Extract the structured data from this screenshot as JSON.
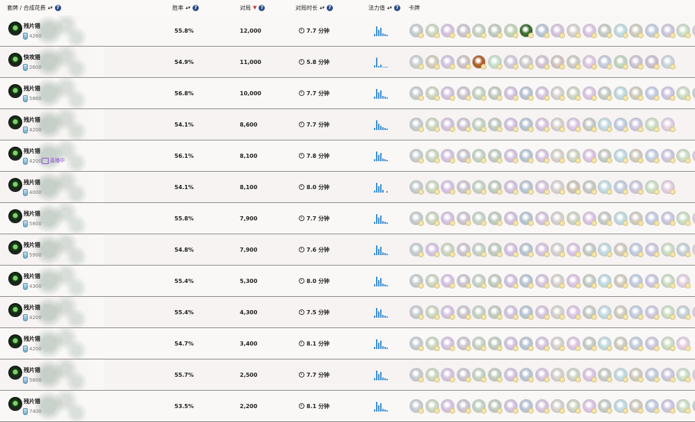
{
  "header": {
    "deck_label": "套牌 / 合成花费",
    "winrate_label": "胜率",
    "games_label": "对局",
    "duration_label": "对局时长",
    "mana_label": "法力值",
    "cards_label": "卡牌",
    "sort_glyph": "▴▾",
    "sort_active_glyph": "▼",
    "help_glyph": "?"
  },
  "rows": [
    {
      "name": "残片猎",
      "dust": "4260",
      "winrate": "55.8%",
      "games": "12,000",
      "duration": "7.7 分钟",
      "live": "",
      "mana": [
        3,
        14,
        9,
        12,
        4,
        3,
        2
      ],
      "cards": [
        "#c9d1d6",
        "#cfdac6",
        "#d9c7e8",
        "#cfc9d4",
        "#c8d7c9",
        "#c4cfc4",
        "#c6d7b9",
        "#3c6e2e",
        "#bac9d9",
        "#d9c8e2",
        "#dbd6d2",
        "#e0c9e8",
        "#c8cfc8",
        "#c4dfe6",
        "#d3cfc1",
        "#c5d0e6",
        "#d0cbe5",
        "#cfe2c8",
        "#e8d2e7"
      ]
    },
    {
      "name": "快攻猎",
      "dust": "2600",
      "winrate": "54.9%",
      "games": "11,000",
      "duration": "5.8 分钟",
      "live": "",
      "mana": [
        3,
        15,
        2,
        4,
        1,
        1,
        1
      ],
      "cards": [
        "#cfd4d6",
        "#d6cfbf",
        "#d8c8e8",
        "#d1c6c9",
        "#b3622c",
        "#c9e4d1",
        "#d4cddf",
        "#d2d2d2",
        "#d4c6d8",
        "#d8c8c5",
        "#d1cfc6",
        "#e2cce8",
        "#c8cfe0",
        "#c5d8c0",
        "#d0c7d8",
        "#cfc0d4",
        "#cddae2"
      ]
    },
    {
      "name": "残片猎",
      "dust": "5860",
      "winrate": "56.8%",
      "games": "10,000",
      "duration": "7.7 分钟",
      "live": "",
      "mana": [
        3,
        14,
        9,
        12,
        4,
        3,
        2
      ],
      "cards": [
        "#c9d1d6",
        "#cfdac6",
        "#d9c7e8",
        "#cfc9d4",
        "#c8d7c9",
        "#c4cfc4",
        "#d6c6e4",
        "#bac9d9",
        "#d9c8e2",
        "#dbd6d2",
        "#d1d8c8",
        "#e0c9e8",
        "#c8cfc8",
        "#c4dfe6",
        "#d3cfc1",
        "#c5d0e6",
        "#d0cbe5",
        "#cfe2c8",
        "#c9d5dc"
      ]
    },
    {
      "name": "残片猎",
      "dust": "4200",
      "winrate": "54.1%",
      "games": "8,600",
      "duration": "7.7 分钟",
      "live": "",
      "mana": [
        3,
        14,
        9,
        6,
        4,
        3,
        2
      ],
      "cards": [
        "#c9d1d6",
        "#cfdac6",
        "#d9c7e8",
        "#cfc9d4",
        "#c8d7c9",
        "#c4cfc4",
        "#d6c6e4",
        "#bac9d9",
        "#d9c8e2",
        "#dbd6d2",
        "#e0c9e8",
        "#c8cfc8",
        "#c4dfe6",
        "#c5d0e6",
        "#d0cbe5",
        "#cfe2c8",
        "#e8d2e7"
      ]
    },
    {
      "name": "残片猎",
      "dust": "4200",
      "winrate": "56.1%",
      "games": "8,100",
      "duration": "7.8 分钟",
      "live": "直播中",
      "mana": [
        3,
        14,
        9,
        12,
        4,
        3,
        2
      ],
      "cards": [
        "#c9d1d6",
        "#cfdac6",
        "#d9c7e8",
        "#cfc9d4",
        "#c8d7c9",
        "#c4cfc4",
        "#d6c6e4",
        "#bac9d9",
        "#d9c8e2",
        "#dbd6d2",
        "#d1d8c8",
        "#e0c9e8",
        "#c8cfc8",
        "#c4dfe6",
        "#d3cfc1",
        "#c5d0e6",
        "#d0cbe5",
        "#cfe2c8",
        "#e8d2e7"
      ]
    },
    {
      "name": "残片猎",
      "dust": "4000",
      "winrate": "54.1%",
      "games": "8,100",
      "duration": "8.0 分钟",
      "live": "",
      "mana": [
        3,
        14,
        9,
        12,
        4,
        0,
        2
      ],
      "cards": [
        "#c9d1d6",
        "#cfdac6",
        "#d9c7e8",
        "#cfc9d4",
        "#c8d7c9",
        "#c4cfc4",
        "#d6c6e4",
        "#bac9d9",
        "#d9c8e2",
        "#dbd6d2",
        "#d1c6b8",
        "#c8cfc8",
        "#c4dfe6",
        "#c5d0e6",
        "#d0cbe5",
        "#cfe2c8",
        "#e8d2e7"
      ]
    },
    {
      "name": "残片猎",
      "dust": "5800",
      "winrate": "55.8%",
      "games": "7,900",
      "duration": "7.7 分钟",
      "live": "",
      "mana": [
        3,
        14,
        9,
        12,
        4,
        3,
        2
      ],
      "cards": [
        "#c9d1d6",
        "#cfdac6",
        "#d9c7e8",
        "#cfc9d4",
        "#c8d7c9",
        "#c4cfc4",
        "#d6c6e4",
        "#bac9d9",
        "#d9c8e2",
        "#dbd6d2",
        "#d1d8c8",
        "#e0c9e8",
        "#c8cfc8",
        "#c4dfe6",
        "#d3cfc1",
        "#c5d0e6",
        "#d0cbe5",
        "#cfe2c8",
        "#e8d2e7"
      ]
    },
    {
      "name": "残片猎",
      "dust": "5900",
      "winrate": "54.8%",
      "games": "7,900",
      "duration": "7.6 分钟",
      "live": "",
      "mana": [
        3,
        14,
        9,
        12,
        4,
        3,
        2
      ],
      "cards": [
        "#c9d1d6",
        "#d9c7e8",
        "#cfdac6",
        "#cfc9d4",
        "#c8d7c9",
        "#c4cfc4",
        "#d6c6e4",
        "#bac9d9",
        "#d9c8e2",
        "#dbd6d2",
        "#e0c9e8",
        "#c8cfc8",
        "#c4dfe6",
        "#d3cfc1",
        "#c5d0e6",
        "#d0cbe5",
        "#cfe2c8",
        "#c9d5dc",
        "#e8d2e7"
      ]
    },
    {
      "name": "残片猎",
      "dust": "4300",
      "winrate": "55.4%",
      "games": "5,300",
      "duration": "8.0 分钟",
      "live": "",
      "mana": [
        3,
        14,
        9,
        12,
        4,
        3,
        2
      ],
      "cards": [
        "#c9d1d6",
        "#cfdac6",
        "#d9c7e8",
        "#cfc9d4",
        "#c8d7c9",
        "#c4cfc4",
        "#d6c6e4",
        "#bac9d9",
        "#d9c8e2",
        "#dbd6d2",
        "#e0c9e8",
        "#c8cfc8",
        "#c4dfe6",
        "#d3cfc1",
        "#c5d0e6",
        "#d0cbe5",
        "#cfe2c8",
        "#e8d2e7"
      ]
    },
    {
      "name": "残片猎",
      "dust": "4200",
      "winrate": "55.4%",
      "games": "4,300",
      "duration": "7.5 分钟",
      "live": "",
      "mana": [
        3,
        14,
        9,
        12,
        4,
        3,
        2
      ],
      "cards": [
        "#c9d1d6",
        "#cfdac6",
        "#d9c7e8",
        "#cfc9d4",
        "#c8d7c9",
        "#c4cfc4",
        "#d6c6e4",
        "#bac9d9",
        "#d9c8e2",
        "#dbd6d2",
        "#e0c9e8",
        "#c8cfc8",
        "#c4dfe6",
        "#d3cfc1",
        "#c5d0e6",
        "#d0cbe5",
        "#cfe2c8",
        "#c9d5dc",
        "#e8d2e7"
      ]
    },
    {
      "name": "残片猎",
      "dust": "4200",
      "winrate": "54.7%",
      "games": "3,400",
      "duration": "8.1 分钟",
      "live": "",
      "mana": [
        3,
        14,
        9,
        12,
        4,
        3,
        2
      ],
      "cards": [
        "#c9d1d6",
        "#cfdac6",
        "#d9c7e8",
        "#cfc9d4",
        "#c8d7c9",
        "#c4cfc4",
        "#d6c6e4",
        "#bac9d9",
        "#d9c8e2",
        "#dbd6d2",
        "#e0c9e8",
        "#c8cfc8",
        "#c4dfe6",
        "#d3cfc1",
        "#c5d0e6",
        "#d0cbe5",
        "#cfe2c8",
        "#e8d2e7"
      ]
    },
    {
      "name": "残片猎",
      "dust": "5800",
      "winrate": "55.7%",
      "games": "2,500",
      "duration": "7.7 分钟",
      "live": "",
      "mana": [
        3,
        14,
        9,
        12,
        4,
        3,
        2
      ],
      "cards": [
        "#c9d1d6",
        "#cfdac6",
        "#d9c7e8",
        "#cfc9d4",
        "#c8d7c9",
        "#c4cfc4",
        "#d6c6e4",
        "#bac9d9",
        "#d9c8e2",
        "#dbd6d2",
        "#d1d8c8",
        "#e0c9e8",
        "#c8cfc8",
        "#c4dfe6",
        "#d3cfc1",
        "#c5d0e6",
        "#d0cbe5",
        "#cfe2c8",
        "#e8d2e7"
      ]
    },
    {
      "name": "残片猎",
      "dust": "7400",
      "winrate": "53.5%",
      "games": "2,200",
      "duration": "8.1 分钟",
      "live": "",
      "mana": [
        3,
        14,
        9,
        12,
        4,
        3,
        2
      ],
      "cards": [
        "#c9d1d6",
        "#cfdac6",
        "#d9c7e8",
        "#cfc9d4",
        "#c8d7c9",
        "#c4cfc4",
        "#d6c6e4",
        "#bac9d9",
        "#d9c8e2",
        "#dbd6d2",
        "#d1d8c8",
        "#e0c9e8",
        "#c8cfc8",
        "#c4dfe6",
        "#d3cfc1",
        "#c5d0e6",
        "#d0cbe5",
        "#cfe2c8",
        "#c9d5dc"
      ]
    }
  ],
  "colors": {
    "mana_bar": "#3d8ed1",
    "live_purple": "#8b4fd8",
    "sort_active": "#c0392b",
    "help_blue": "#2a4d8a"
  }
}
